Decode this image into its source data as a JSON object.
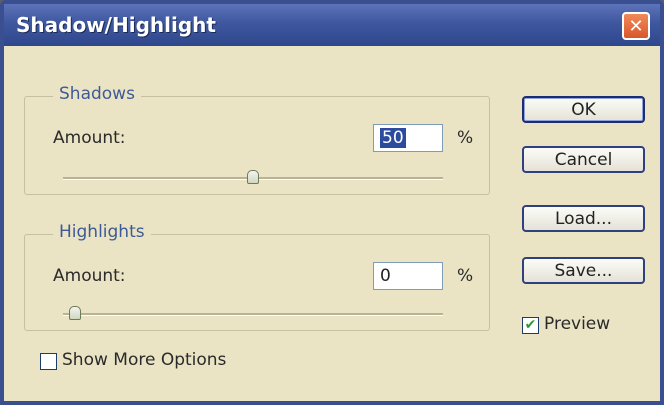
{
  "window": {
    "title": "Shadow/Highlight",
    "close_glyph": "✕"
  },
  "shadows": {
    "group_label": "Shadows",
    "amount_label": "Amount:",
    "amount_value": "50",
    "unit": "%",
    "slider_fraction": 0.5
  },
  "highlights": {
    "group_label": "Highlights",
    "amount_label": "Amount:",
    "amount_value": "0",
    "unit": "%",
    "slider_fraction": 0.0
  },
  "buttons": {
    "ok": "OK",
    "cancel": "Cancel",
    "load": "Load...",
    "save": "Save..."
  },
  "preview": {
    "label": "Preview",
    "checked": true,
    "check_glyph": "✔"
  },
  "show_more": {
    "label": "Show More Options",
    "checked": false
  },
  "colors": {
    "title_bar": "#3e579f",
    "dialog_bg": "#eae4c5",
    "group_title": "#3e5a96"
  }
}
